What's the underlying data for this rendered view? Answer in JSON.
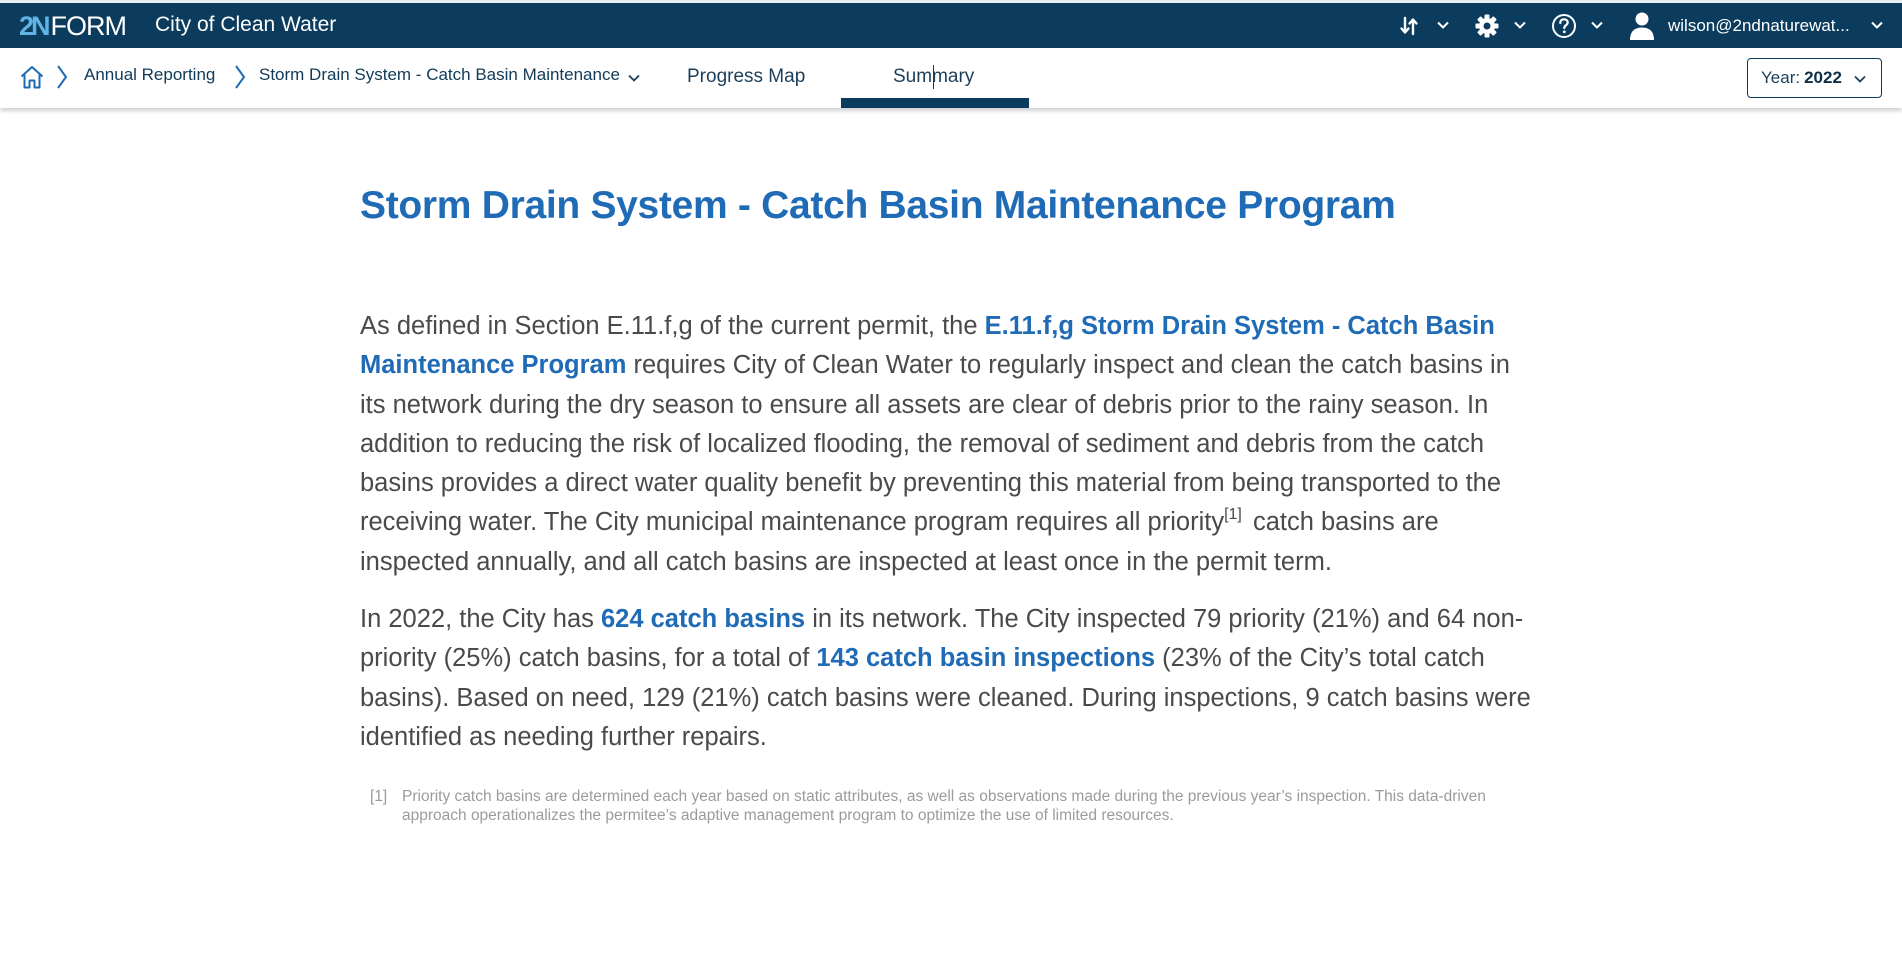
{
  "header": {
    "logo": {
      "part1": "2",
      "part2": "N",
      "part3": "FORM"
    },
    "app_title": "City of Clean Water",
    "icons": [
      "sort-icon",
      "gear-icon",
      "help-icon",
      "user-icon"
    ],
    "user_email": "wilson@2ndnaturewat..."
  },
  "nav": {
    "breadcrumb": [
      {
        "icon": "home-icon"
      },
      {
        "label": "Annual Reporting"
      },
      {
        "label": "Storm Drain System - Catch Basin Maintenance",
        "has_dropdown": true
      }
    ],
    "tabs": [
      {
        "label": "Progress Map",
        "active": false
      },
      {
        "label": "Summary",
        "active": true
      }
    ],
    "year_select": {
      "label": "Year:",
      "value": "2022"
    }
  },
  "main": {
    "title": "Storm Drain System - Catch Basin Maintenance Program",
    "paragraph1": {
      "t1": "As defined in Section E.11.f,g of the current permit, the ",
      "h1": "E.11.f,g Storm Drain System - Catch Basin Maintenance Program",
      "t2": " requires City of Clean Water to regularly inspect and clean the catch basins in its network during the dry season to ensure all assets are clear of debris prior to the rainy season. In addition to reducing the risk of localized flooding, the removal of sediment and debris from the catch basins provides a direct water quality benefit by preventing this material from being transported to the receiving water. The City municipal maintenance program requires all priority",
      "sup": "[1]",
      "t3": " catch basins are inspected annually, and all catch basins are inspected at least once in the permit term."
    },
    "paragraph2": {
      "t1": "In 2022, the City has ",
      "h1": "624 catch basins",
      "t2": " in its network. The City inspected 79 priority (21%) and 64 non-priority (25%) catch basins, for a total of ",
      "h2": "143 catch basin inspections",
      "t3": " (23% of the City’s total catch basins). Based on need, 129 (21%) catch basins were cleaned. During inspections, 9 catch basins were identified as needing further repairs."
    },
    "footnote": {
      "mark": "[1]",
      "text": "Priority catch basins are determined each year based on static attributes, as well as observations made during the previous year’s inspection. This data-driven approach operationalizes the permitee’s adaptive management program to optimize the use of limited resources."
    }
  },
  "colors": {
    "header_bg": "#0b3c5d",
    "accent": "#1f6bb5",
    "body_text": "#4a4a4a",
    "footnote_text": "#9b9b9b"
  }
}
